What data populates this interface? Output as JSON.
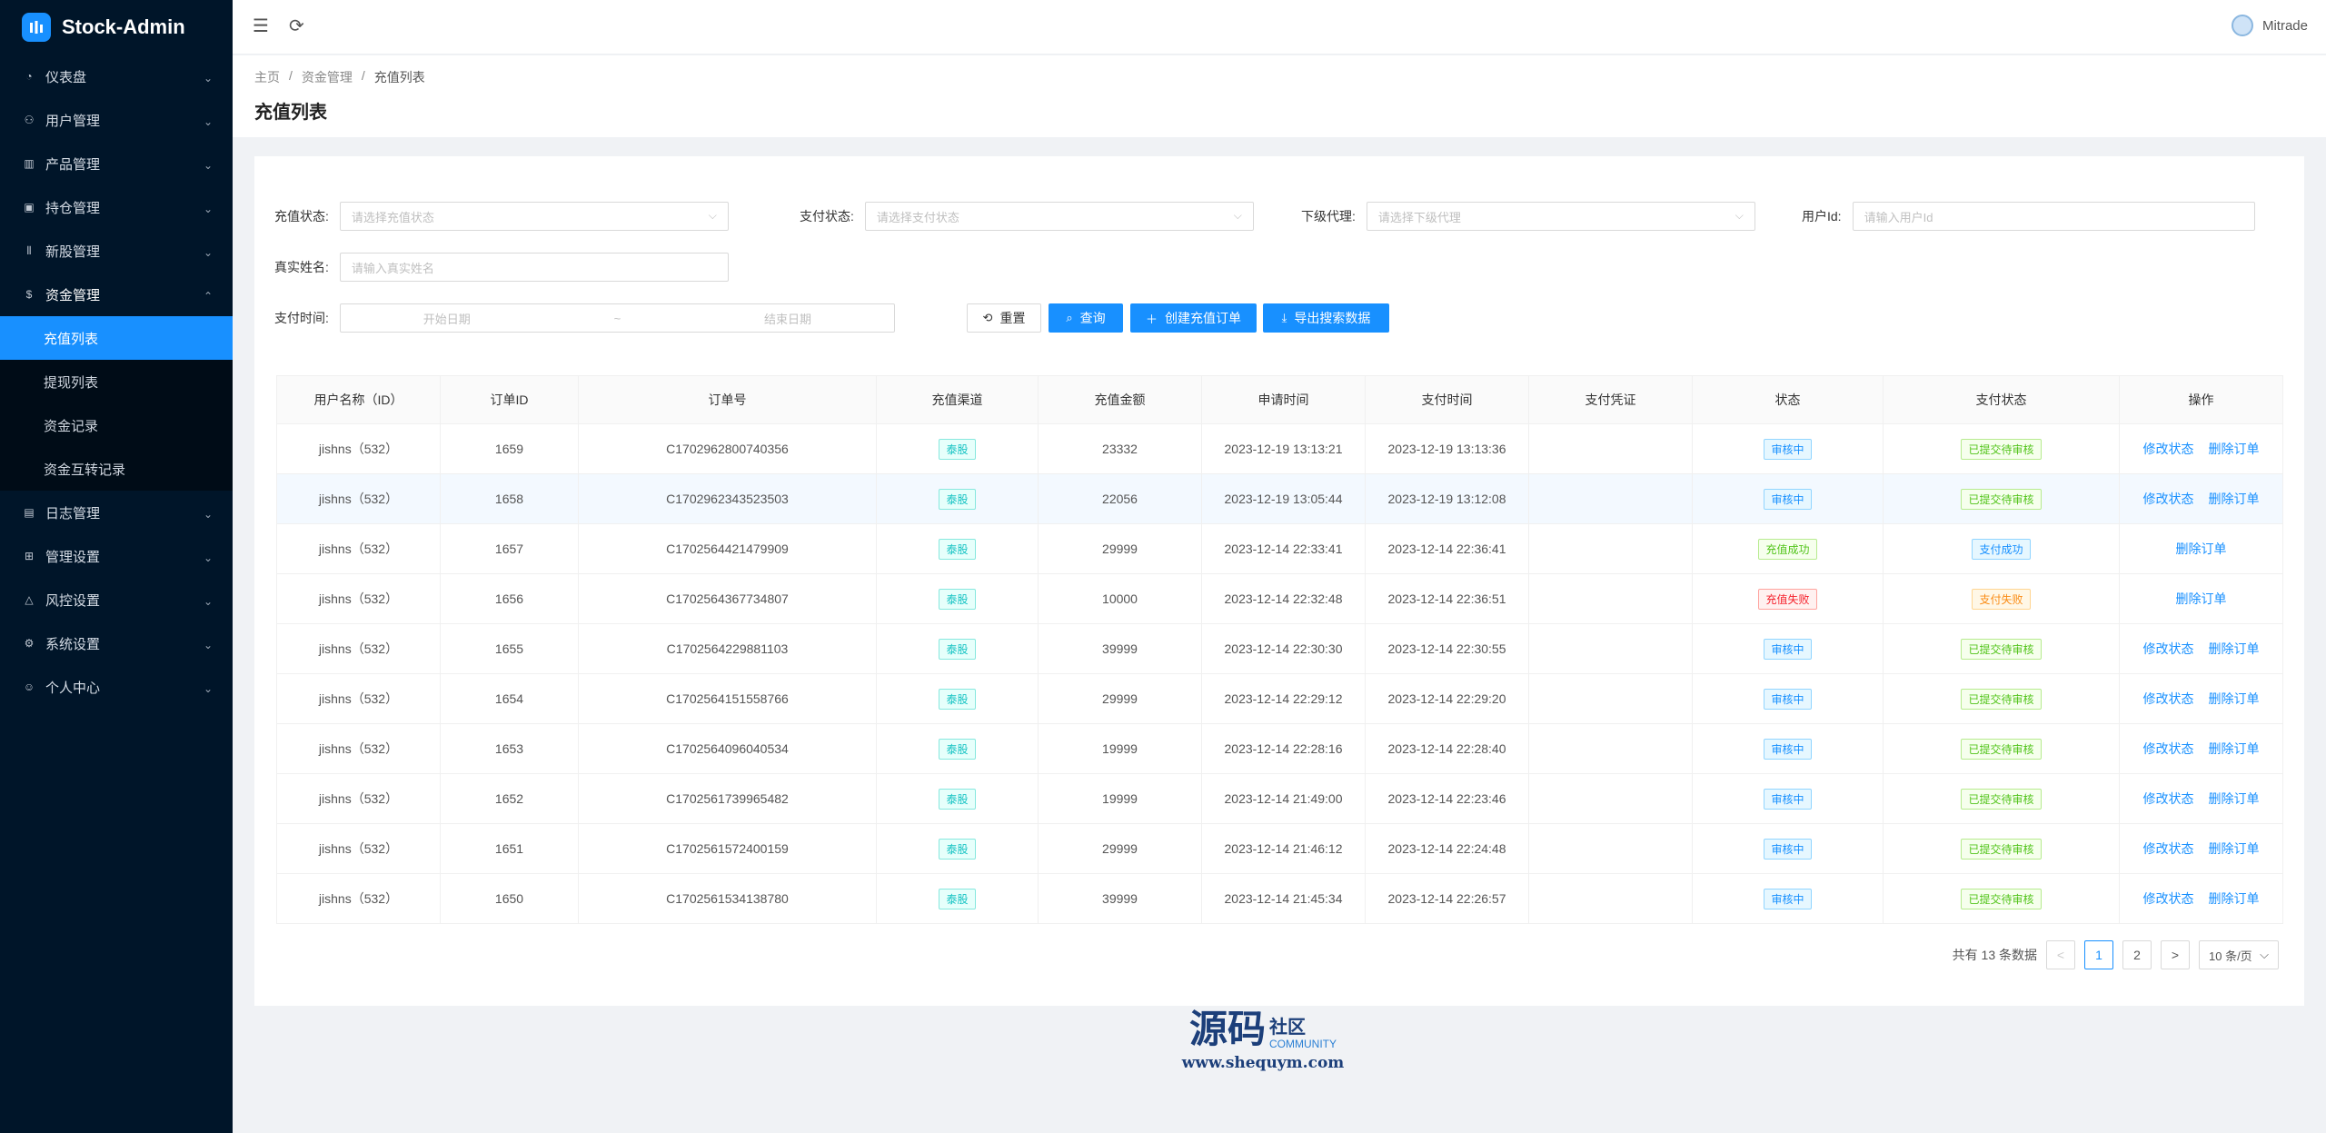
{
  "app": {
    "title": "Stock-Admin"
  },
  "sidebar": {
    "items": [
      {
        "label": "仪表盘",
        "icon": "dashboard-icon"
      },
      {
        "label": "用户管理",
        "icon": "users-icon"
      },
      {
        "label": "产品管理",
        "icon": "chart-icon"
      },
      {
        "label": "持仓管理",
        "icon": "position-icon"
      },
      {
        "label": "新股管理",
        "icon": "ipo-icon"
      },
      {
        "label": "资金管理",
        "icon": "money-icon",
        "open": true
      },
      {
        "label": "日志管理",
        "icon": "log-icon"
      },
      {
        "label": "管理设置",
        "icon": "admin-settings-icon"
      },
      {
        "label": "风控设置",
        "icon": "warning-icon"
      },
      {
        "label": "系统设置",
        "icon": "settings-icon"
      },
      {
        "label": "个人中心",
        "icon": "user-icon"
      }
    ],
    "sub_items": [
      "充值列表",
      "提现列表",
      "资金记录",
      "资金互转记录"
    ]
  },
  "header": {
    "username": "Mitrade"
  },
  "breadcrumb": [
    "主页",
    "资金管理",
    "充值列表"
  ],
  "page_title": "充值列表",
  "filters": {
    "recharge_status": {
      "label": "充值状态:",
      "placeholder": "请选择充值状态"
    },
    "pay_status": {
      "label": "支付状态:",
      "placeholder": "请选择支付状态"
    },
    "agent": {
      "label": "下级代理:",
      "placeholder": "请选择下级代理"
    },
    "user_id": {
      "label": "用户Id:",
      "placeholder": "请输入用户Id"
    },
    "real_name": {
      "label": "真实姓名:",
      "placeholder": "请输入真实姓名"
    },
    "pay_time": {
      "label": "支付时间:",
      "start": "开始日期",
      "sep": "~",
      "end": "结束日期"
    }
  },
  "buttons": {
    "reset": "重置",
    "query": "查询",
    "create": "创建充值订单",
    "export": "导出搜索数据"
  },
  "table": {
    "columns": [
      "用户名称（ID）",
      "订单ID",
      "订单号",
      "充值渠道",
      "充值金额",
      "申请时间",
      "支付时间",
      "支付凭证",
      "状态",
      "支付状态",
      "操作"
    ],
    "rows": [
      {
        "user": "jishns（532）",
        "id": "1659",
        "order_no": "C1702962800740356",
        "channel": "泰股",
        "amount": "23332",
        "apply_time": "2023-12-19 13:13:21",
        "pay_time": "2023-12-19 13:13:36",
        "status": "审核中",
        "pay_status": "已提交待审核",
        "actions": [
          "修改状态",
          "删除订单"
        ]
      },
      {
        "user": "jishns（532）",
        "id": "1658",
        "order_no": "C1702962343523503",
        "channel": "泰股",
        "amount": "22056",
        "apply_time": "2023-12-19 13:05:44",
        "pay_time": "2023-12-19 13:12:08",
        "status": "审核中",
        "pay_status": "已提交待审核",
        "actions": [
          "修改状态",
          "删除订单"
        ]
      },
      {
        "user": "jishns（532）",
        "id": "1657",
        "order_no": "C1702564421479909",
        "channel": "泰股",
        "amount": "29999",
        "apply_time": "2023-12-14 22:33:41",
        "pay_time": "2023-12-14 22:36:41",
        "status": "充值成功",
        "pay_status": "支付成功",
        "actions": [
          "删除订单"
        ]
      },
      {
        "user": "jishns（532）",
        "id": "1656",
        "order_no": "C1702564367734807",
        "channel": "泰股",
        "amount": "10000",
        "apply_time": "2023-12-14 22:32:48",
        "pay_time": "2023-12-14 22:36:51",
        "status": "充值失败",
        "pay_status": "支付失败",
        "actions": [
          "删除订单"
        ]
      },
      {
        "user": "jishns（532）",
        "id": "1655",
        "order_no": "C1702564229881103",
        "channel": "泰股",
        "amount": "39999",
        "apply_time": "2023-12-14 22:30:30",
        "pay_time": "2023-12-14 22:30:55",
        "status": "审核中",
        "pay_status": "已提交待审核",
        "actions": [
          "修改状态",
          "删除订单"
        ]
      },
      {
        "user": "jishns（532）",
        "id": "1654",
        "order_no": "C1702564151558766",
        "channel": "泰股",
        "amount": "29999",
        "apply_time": "2023-12-14 22:29:12",
        "pay_time": "2023-12-14 22:29:20",
        "status": "审核中",
        "pay_status": "已提交待审核",
        "actions": [
          "修改状态",
          "删除订单"
        ]
      },
      {
        "user": "jishns（532）",
        "id": "1653",
        "order_no": "C1702564096040534",
        "channel": "泰股",
        "amount": "19999",
        "apply_time": "2023-12-14 22:28:16",
        "pay_time": "2023-12-14 22:28:40",
        "status": "审核中",
        "pay_status": "已提交待审核",
        "actions": [
          "修改状态",
          "删除订单"
        ]
      },
      {
        "user": "jishns（532）",
        "id": "1652",
        "order_no": "C1702561739965482",
        "channel": "泰股",
        "amount": "19999",
        "apply_time": "2023-12-14 21:49:00",
        "pay_time": "2023-12-14 22:23:46",
        "status": "审核中",
        "pay_status": "已提交待审核",
        "actions": [
          "修改状态",
          "删除订单"
        ]
      },
      {
        "user": "jishns（532）",
        "id": "1651",
        "order_no": "C1702561572400159",
        "channel": "泰股",
        "amount": "29999",
        "apply_time": "2023-12-14 21:46:12",
        "pay_time": "2023-12-14 22:24:48",
        "status": "审核中",
        "pay_status": "已提交待审核",
        "actions": [
          "修改状态",
          "删除订单"
        ]
      },
      {
        "user": "jishns（532）",
        "id": "1650",
        "order_no": "C1702561534138780",
        "channel": "泰股",
        "amount": "39999",
        "apply_time": "2023-12-14 21:45:34",
        "pay_time": "2023-12-14 22:26:57",
        "status": "审核中",
        "pay_status": "已提交待审核",
        "actions": [
          "修改状态",
          "删除订单"
        ]
      }
    ]
  },
  "pagination": {
    "total_text": "共有 13 条数据",
    "prev": "<",
    "pages": [
      "1",
      "2"
    ],
    "current": "1",
    "next": ">",
    "page_size": "10 条/页"
  },
  "watermark": {
    "big": "源码",
    "small": "社区",
    "en": "COMMUNITY",
    "url": "www.shequym.com"
  },
  "colors": {
    "primary": "#1890ff",
    "sidebar_bg": "#001529",
    "submenu_bg": "#000c17"
  }
}
